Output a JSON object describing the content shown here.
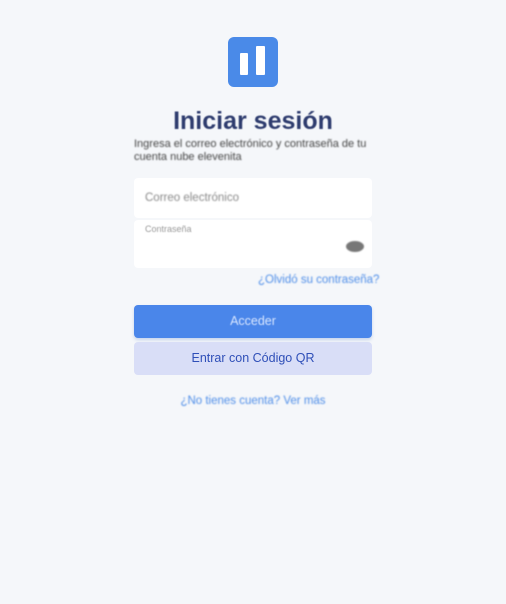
{
  "header": {
    "logo_icon": "bar-chart-logo-icon",
    "title": "Iniciar sesión",
    "subtitle": "Ingresa el correo electrónico y contraseña de tu cuenta nube elevenita"
  },
  "form": {
    "email": {
      "placeholder": "Correo electrónico",
      "value": ""
    },
    "password": {
      "label": "Contraseña",
      "value": "",
      "toggle_icon": "eye-icon"
    },
    "forgot_link": "¿Olvidó su contraseña?",
    "submit_label": "Acceder",
    "qr_label": "Entrar con Código QR",
    "signup_link": "¿No tienes cuenta? Ver más"
  },
  "colors": {
    "background": "#f5f7fa",
    "accent": "#4a86ea",
    "title": "#2e3c6e",
    "qr_button": "#d9def7",
    "link": "#4f8ee8"
  }
}
